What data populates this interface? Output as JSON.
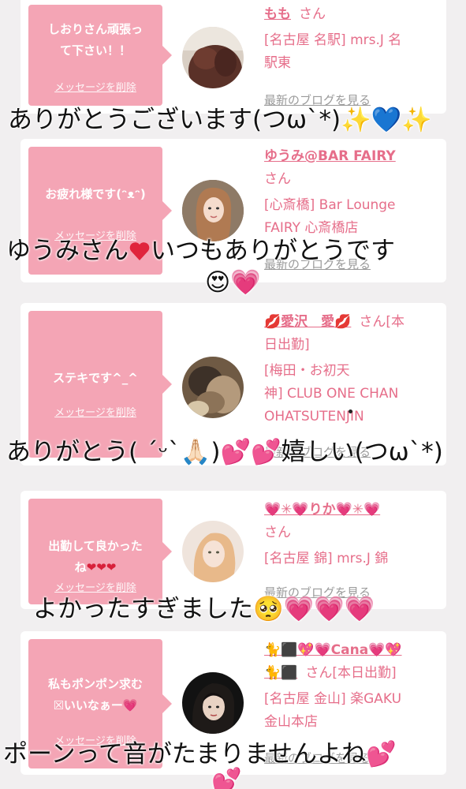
{
  "cards": [
    {
      "bubble_message": "しおりさん頑張っ\nて下さい！！",
      "delete_label": "メッセージを削除",
      "name": "もも",
      "san": "さん",
      "shop_lines": [
        "[名古屋 名駅] mrs.J 名",
        "駅東"
      ],
      "blog_label": "最新のブログを見る",
      "caption": "ありがとうございます(つω`*)✨💙✨"
    },
    {
      "bubble_message": "お疲れ様です(ᵔᴥᵔ)",
      "delete_label": "メッセージを削除",
      "name": "ゆうみ@BAR FAIRY",
      "san": "さん",
      "shop_lines": [
        "[心斎橋] Bar Lounge",
        "FAIRY 心斎橋店"
      ],
      "blog_label": "最新のブログを見る",
      "caption_line1": "ゆうみさん",
      "caption_line1b": "いつもありがとうです",
      "caption_line2": "😍💗"
    },
    {
      "bubble_message": "ステキです^_^",
      "delete_label": "メッセージを削除",
      "name": "💋愛沢　愛💋",
      "san": "さん[本",
      "name_line2": "日出勤]",
      "shop_lines": [
        "[梅田・お初天",
        "神] CLUB ONE CHAN",
        "OHATSUTENJIN"
      ],
      "blog_label": "最新のブログを見る",
      "caption": "ありがとう( ˊᵕˋ🙏🏻)💕💕嬉しい(つω`*)"
    },
    {
      "bubble_message": "出勤して良かった\nね",
      "bubble_hearts": "❤❤❤",
      "delete_label": "メッセージを削除",
      "name": "💗✳💗りか💗✳💗",
      "san": "さん",
      "shop_lines": [
        "[名古屋 錦] mrs.J 錦"
      ],
      "blog_label": "最新のブログを見る",
      "caption": "よかったすぎました🥺💗💗💗"
    },
    {
      "bubble_message": "私もポンポン求む\n☒いいなぁー💗",
      "delete_label": "メッセージを削除",
      "name": "🐈⬛💖💗Cana💗💖",
      "name_line2": "🐈⬛",
      "san": "さん[本日出勤]",
      "shop_lines": [
        "[名古屋 金山] 楽GAKU",
        "金山本店"
      ],
      "blog_label": "最新のブログを見る",
      "caption": "ポーンって音がたまりませんよね💕",
      "caption_line2": "💕"
    }
  ],
  "colors": {
    "bubble": "#f4a5b5",
    "accent_pink": "#e66e8a",
    "page_bg": "#f1eff0",
    "blog_gray": "#9a9a9a"
  }
}
